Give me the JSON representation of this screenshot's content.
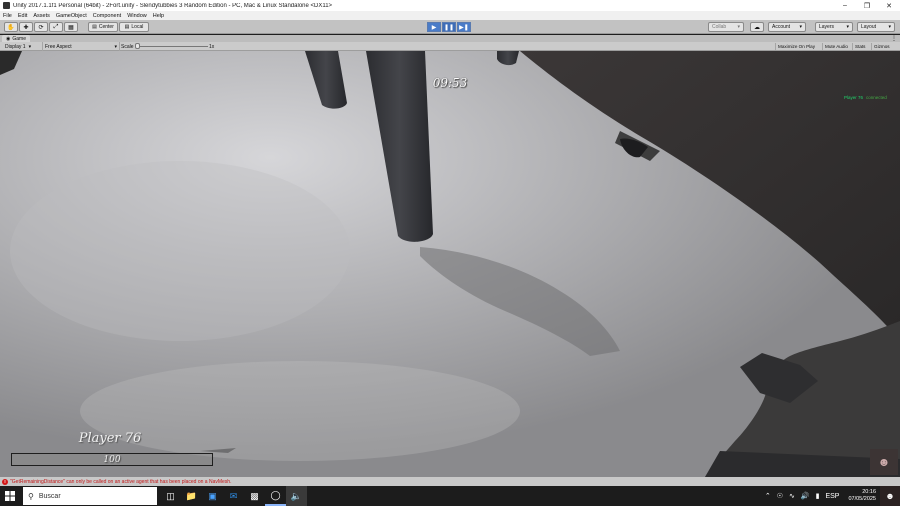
{
  "window": {
    "title": "Unity 2017.1.1f1 Personal (64bit) - 2Fort.unity - Slendytubbies 3 Random Edition - PC, Mac & Linux Standalone <DX11>",
    "minimize_icon": "minimize-icon",
    "maximize_icon": "restore-icon",
    "close_icon": "close-icon"
  },
  "menu": [
    "File",
    "Edit",
    "Assets",
    "GameObject",
    "Component",
    "Window",
    "Help"
  ],
  "toolbar": {
    "tools": [
      "hand-tool-icon",
      "move-tool-icon",
      "rotate-tool-icon",
      "scale-tool-icon",
      "rect-tool-icon"
    ],
    "pivot_label": "Center",
    "space_label": "Local",
    "play_icon": "play-icon",
    "pause_icon": "pause-icon",
    "step_icon": "step-icon",
    "collab_label": "Collab",
    "account_label": "Account",
    "layers_label": "Layers",
    "layout_label": "Layout"
  },
  "game_tab": {
    "label": "Game"
  },
  "game_toolbar": {
    "display": "Display 1",
    "aspect": "Free Aspect",
    "scale_label": "Scale",
    "scale_value": "1x",
    "maximize_on_play": "Maximize On Play",
    "mute_audio": "Mute Audio",
    "stats": "Stats",
    "gizmos": "Gizmos"
  },
  "hud": {
    "timer": "09:53",
    "player_list_name": "Player 76",
    "player_list_status": "connected",
    "player_name": "Player 76",
    "health_value": "100",
    "health_fraction": 1.0
  },
  "console": {
    "message": "\"GetRemainingDistance\" can only be called on an active agent that has been placed on a NavMesh."
  },
  "taskbar": {
    "search_placeholder": "Buscar",
    "apps": [
      "task-view-icon",
      "file-explorer-icon",
      "store-icon",
      "mail-icon",
      "terminal-icon",
      "unity-icon",
      "audio-app-icon"
    ],
    "language": "ESP",
    "time": "20:16",
    "date": "07/05/2025"
  },
  "colors": {
    "hud_green": "#1fd36b",
    "error_red": "#c21515",
    "play_blue": "#4a7cc8"
  }
}
